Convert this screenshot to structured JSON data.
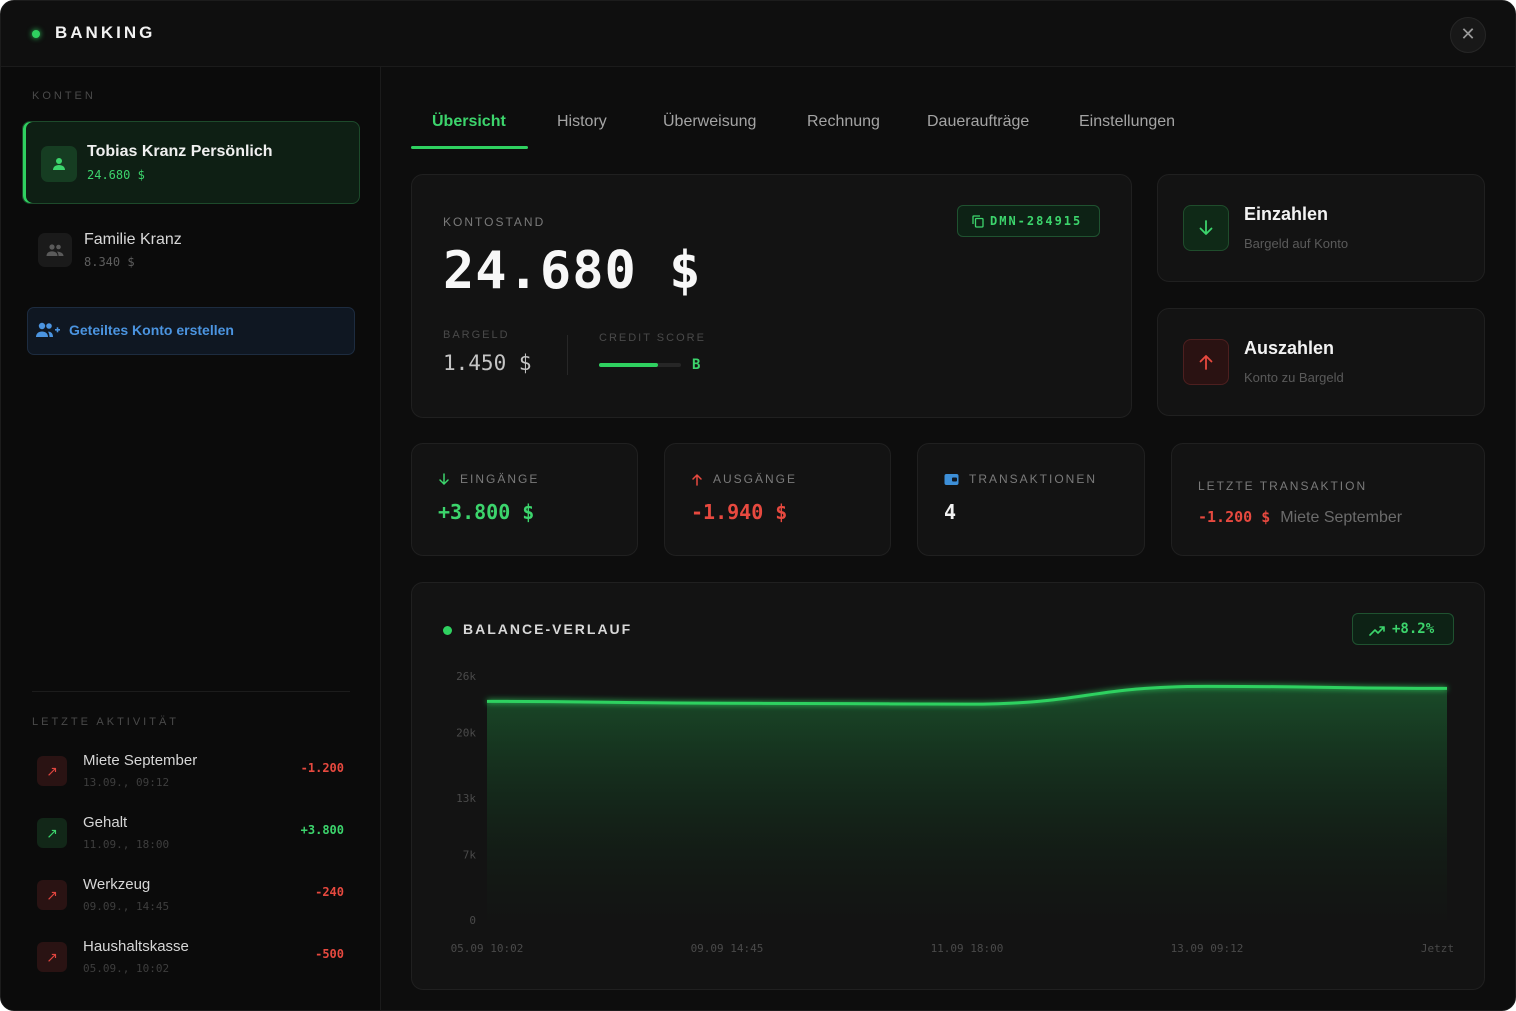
{
  "app": {
    "title": "BANKING",
    "close_glyph": "✕"
  },
  "colors": {
    "accent": "#2fd160",
    "negative": "#e7493f",
    "info": "#4b94e0"
  },
  "sidebar": {
    "accounts_label": "KONTEN",
    "accounts": [
      {
        "name": "Tobias Kranz Persönlich",
        "balance": "24.680 $",
        "icon": "user-icon",
        "active": true
      },
      {
        "name": "Familie Kranz",
        "balance": "8.340 $",
        "icon": "users-icon",
        "active": false
      }
    ],
    "create_shared_label": "Geteiltes Konto erstellen",
    "activity_label": "LETZTE AKTIVITÄT",
    "activity": [
      {
        "title": "Miete September",
        "date": "13.09., 09:12",
        "amount": "-1.200",
        "direction": "out"
      },
      {
        "title": "Gehalt",
        "date": "11.09., 18:00",
        "amount": "+3.800",
        "direction": "in"
      },
      {
        "title": "Werkzeug",
        "date": "09.09., 14:45",
        "amount": "-240",
        "direction": "out"
      },
      {
        "title": "Haushaltskasse",
        "date": "05.09., 10:02",
        "amount": "-500",
        "direction": "out"
      }
    ]
  },
  "tabs": [
    "Übersicht",
    "History",
    "Überweisung",
    "Rechnung",
    "Daueraufträge",
    "Einstellungen"
  ],
  "active_tab": "Übersicht",
  "balance": {
    "label": "KONTOSTAND",
    "amount": "24.680 $",
    "account_id": "DMN-284915",
    "cash_label": "BARGELD",
    "cash": "1.450 $",
    "credit_label": "CREDIT SCORE",
    "credit_grade": "B",
    "credit_level": 0.72
  },
  "actions": {
    "deposit": {
      "title": "Einzahlen",
      "subtitle": "Bargeld auf Konto"
    },
    "withdraw": {
      "title": "Auszahlen",
      "subtitle": "Konto zu Bargeld"
    }
  },
  "stats": {
    "income": {
      "label": "EINGÄNGE",
      "value": "+3.800 $"
    },
    "expenses": {
      "label": "AUSGÄNGE",
      "value": "-1.940 $"
    },
    "transactions": {
      "label": "TRANSAKTIONEN",
      "value": "4"
    },
    "last": {
      "label": "LETZTE TRANSAKTION",
      "amount": "-1.200 $",
      "description": "Miete September"
    }
  },
  "chart_data": {
    "type": "area",
    "title": "BALANCE-VERLAUF",
    "trend": "+8.2%",
    "y_ticks": [
      "26k",
      "20k",
      "13k",
      "7k",
      "0"
    ],
    "x_ticks": [
      "05.09 10:02",
      "09.09 14:45",
      "11.09 18:00",
      "13.09 09:12",
      "Jetzt"
    ],
    "ylim": [
      0,
      26000
    ],
    "grid": false,
    "series": [
      {
        "x": [
          "05.09 10:02",
          "09.09 14:45",
          "11.09 18:00",
          "13.09 09:12",
          "Jetzt"
        ],
        "values": [
          23300,
          23100,
          23000,
          24900,
          24680
        ]
      }
    ]
  }
}
